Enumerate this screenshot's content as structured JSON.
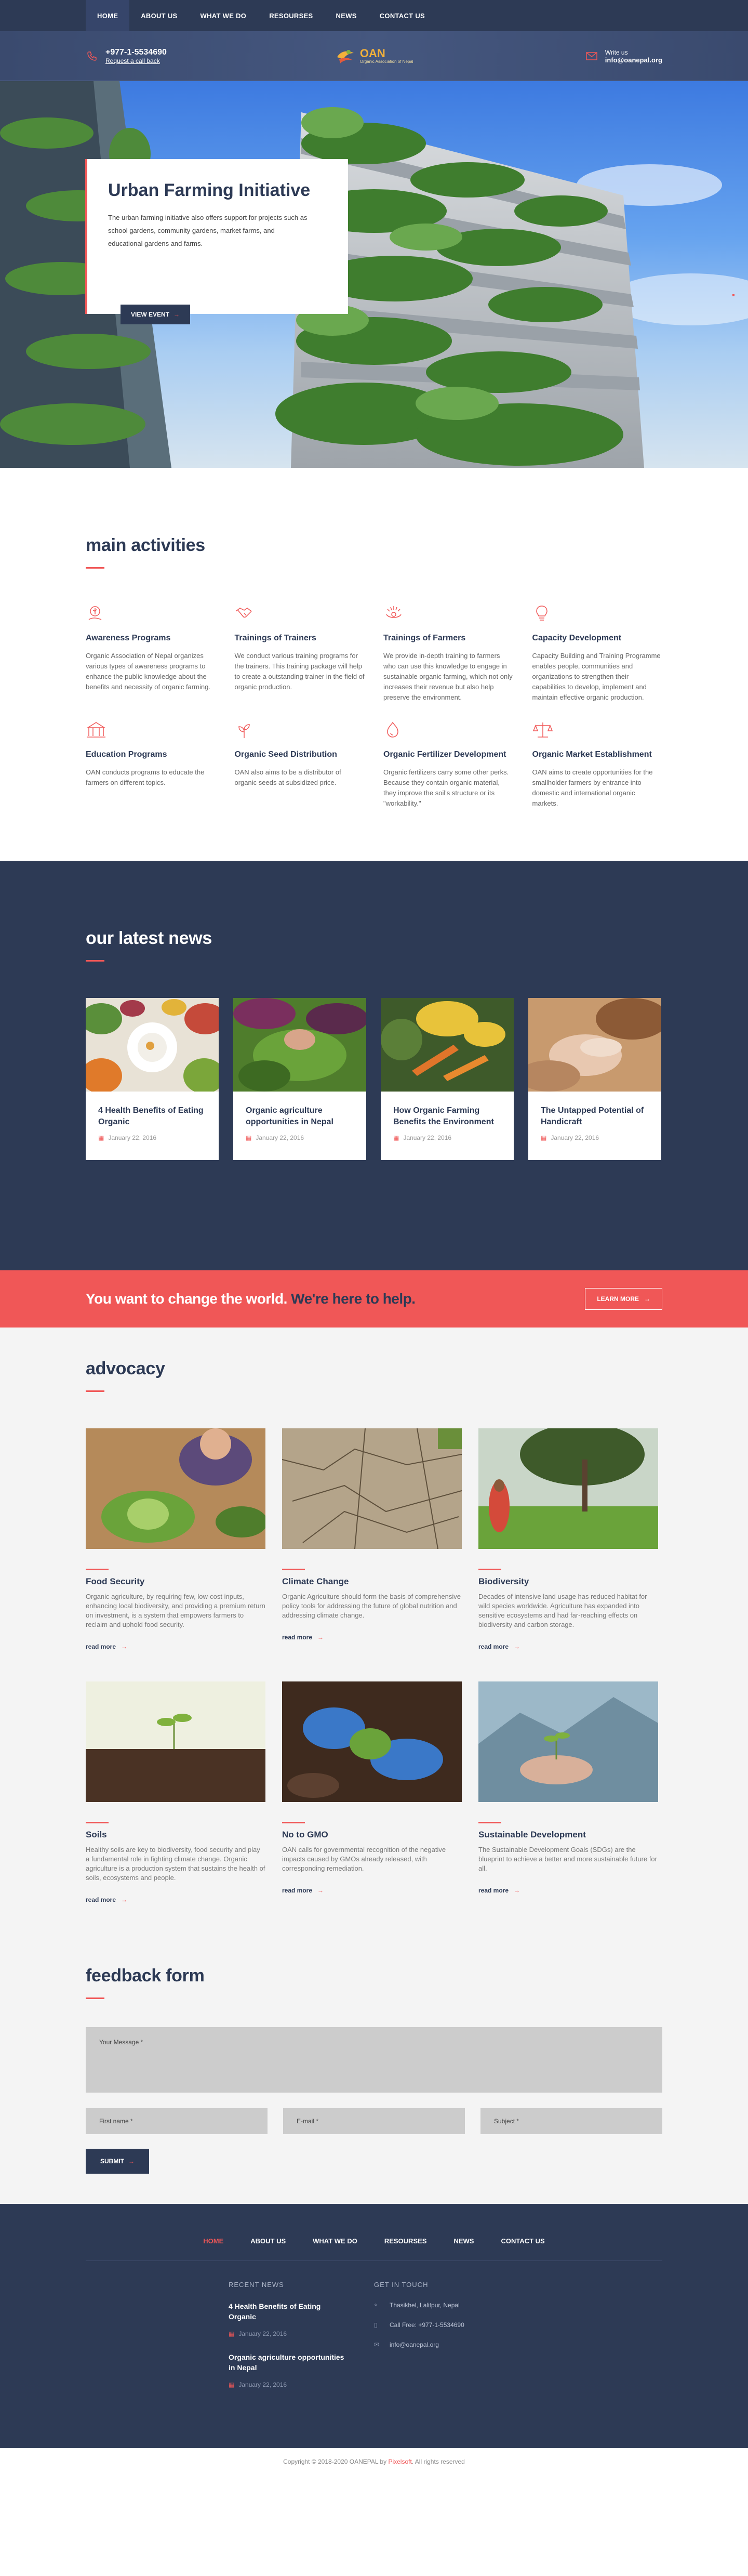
{
  "nav": {
    "items": [
      {
        "label": "HOME"
      },
      {
        "label": "ABOUT US"
      },
      {
        "label": "WHAT WE DO"
      },
      {
        "label": "RESOURSES"
      },
      {
        "label": "NEWS"
      },
      {
        "label": "CONTACT US"
      }
    ]
  },
  "header": {
    "phone": "+977-1-5534690",
    "callback": "Request a call back",
    "logo_name": "OAN",
    "logo_sub": "Organic Association of Nepal",
    "write_label": "Write us",
    "email": "info@oanepal.org"
  },
  "hero": {
    "title": "Urban Farming Initiative",
    "text": "The urban farming initiative also offers support for projects such as school gardens, community gardens, market farms, and educational gardens and farms.",
    "button": "VIEW EVENT"
  },
  "activities": {
    "title": "main activities",
    "items": [
      {
        "icon": "hand-plant-icon",
        "title": "Awareness Programs",
        "text": "Organic Association of Nepal organizes various types of awareness programs to enhance the public knowledge about the benefits and necessity of organic farming."
      },
      {
        "icon": "handshake-icon",
        "title": "Trainings of Trainers",
        "text": "We conduct various training programs for the trainers. This training package will help to create a outstanding trainer in the field of organic production."
      },
      {
        "icon": "farmer-icon",
        "title": "Trainings of Farmers",
        "text": "We provide in-depth training to farmers who can use this knowledge to engage in sustainable organic farming, which not only increases their revenue but also help preserve the environment."
      },
      {
        "icon": "bulb-icon",
        "title": "Capacity Development",
        "text": "Capacity Building and Training Programme enables people, communities and organizations to strengthen their capabilities to develop, implement and maintain effective organic production."
      },
      {
        "icon": "school-icon",
        "title": "Education Programs",
        "text": "OAN conducts programs to educate the farmers on different topics."
      },
      {
        "icon": "seed-icon",
        "title": "Organic Seed Distribution",
        "text": "OAN also aims to be a distributor of organic seeds at subsidized price."
      },
      {
        "icon": "fertilizer-icon",
        "title": "Organic Fertilizer Development",
        "text": "Organic fertilizers carry some other perks. Because they contain organic material, they improve the soil's structure or its \"workability.\""
      },
      {
        "icon": "scale-icon",
        "title": "Organic Market Establishment",
        "text": "OAN aims to create opportunities for the smallholder farmers by entrance into domestic and international organic markets."
      }
    ]
  },
  "news": {
    "title": "our latest news",
    "items": [
      {
        "title": "4 Health Benefits of Eating Organic",
        "date": "January 22, 2016"
      },
      {
        "title": "Organic agriculture opportunities in Nepal",
        "date": "January 22, 2016"
      },
      {
        "title": "How Organic Farming Benefits the Environment",
        "date": "January 22, 2016"
      },
      {
        "title": "The Untapped Potential of Handicraft",
        "date": "January 22, 2016"
      }
    ]
  },
  "cta": {
    "text_white": "You want to change the world.",
    "text_navy": "We're here to help.",
    "button": "LEARN MORE"
  },
  "advocacy": {
    "title": "advocacy",
    "more_label": "read more",
    "items": [
      {
        "title": "Food Security",
        "text": "Organic agriculture, by requiring few, low-cost inputs, enhancing local biodiversity, and providing a premium return on investment, is a system that empowers farmers to reclaim and uphold food security."
      },
      {
        "title": "Climate Change",
        "text": "Organic Agriculture should form the basis of comprehensive policy tools for addressing the future of global nutrition and addressing climate change."
      },
      {
        "title": "Biodiversity",
        "text": "Decades of intensive land usage has reduced habitat for wild species worldwide. Agriculture has expanded into sensitive ecosystems and had far-reaching effects on biodiversity and carbon storage."
      },
      {
        "title": "Soils",
        "text": "Healthy soils are key to biodiversity, food security and play a fundamental role in fighting climate change. Organic agriculture is a production system that sustains the health of soils, ecosystems and people."
      },
      {
        "title": "No to GMO",
        "text": "OAN calls for governmental recognition of the negative impacts caused by GMOs already released, with corresponding remediation."
      },
      {
        "title": "Sustainable Development",
        "text": "The Sustainable Development Goals (SDGs) are the blueprint to achieve a better and more sustainable future for all."
      }
    ]
  },
  "feedback": {
    "title": "feedback form",
    "message_placeholder": "Your Message *",
    "first_name_placeholder": "First name *",
    "email_placeholder": "E-mail *",
    "subject_placeholder": "Subject *",
    "submit": "SUBMIT"
  },
  "footer": {
    "nav": [
      {
        "label": "HOME"
      },
      {
        "label": "ABOUT US"
      },
      {
        "label": "WHAT WE DO"
      },
      {
        "label": "RESOURSES"
      },
      {
        "label": "NEWS"
      },
      {
        "label": "CONTACT US"
      }
    ],
    "recent_news_title": "RECENT NEWS",
    "recent_news": [
      {
        "title": "4 Health Benefits of Eating Organic",
        "date": "January 22, 2016"
      },
      {
        "title": "Organic agriculture opportunities in Nepal",
        "date": "January 22, 2016"
      }
    ],
    "get_in_touch_title": "GET IN TOUCH",
    "address": "Thasikhel, Lalitpur, Nepal",
    "phone": "Call Free: +977-1-5534690",
    "email": "info@oanepal.org",
    "copyright_prefix": "Copyright © 2018-2020 OANEPAL by",
    "copyright_brand": "Pixelsoft",
    "copyright_suffix": ". All rights reserved"
  },
  "colors": {
    "navy": "#2d3a55",
    "accent_red": "#f05757",
    "light_bg": "#f4f4f4"
  }
}
